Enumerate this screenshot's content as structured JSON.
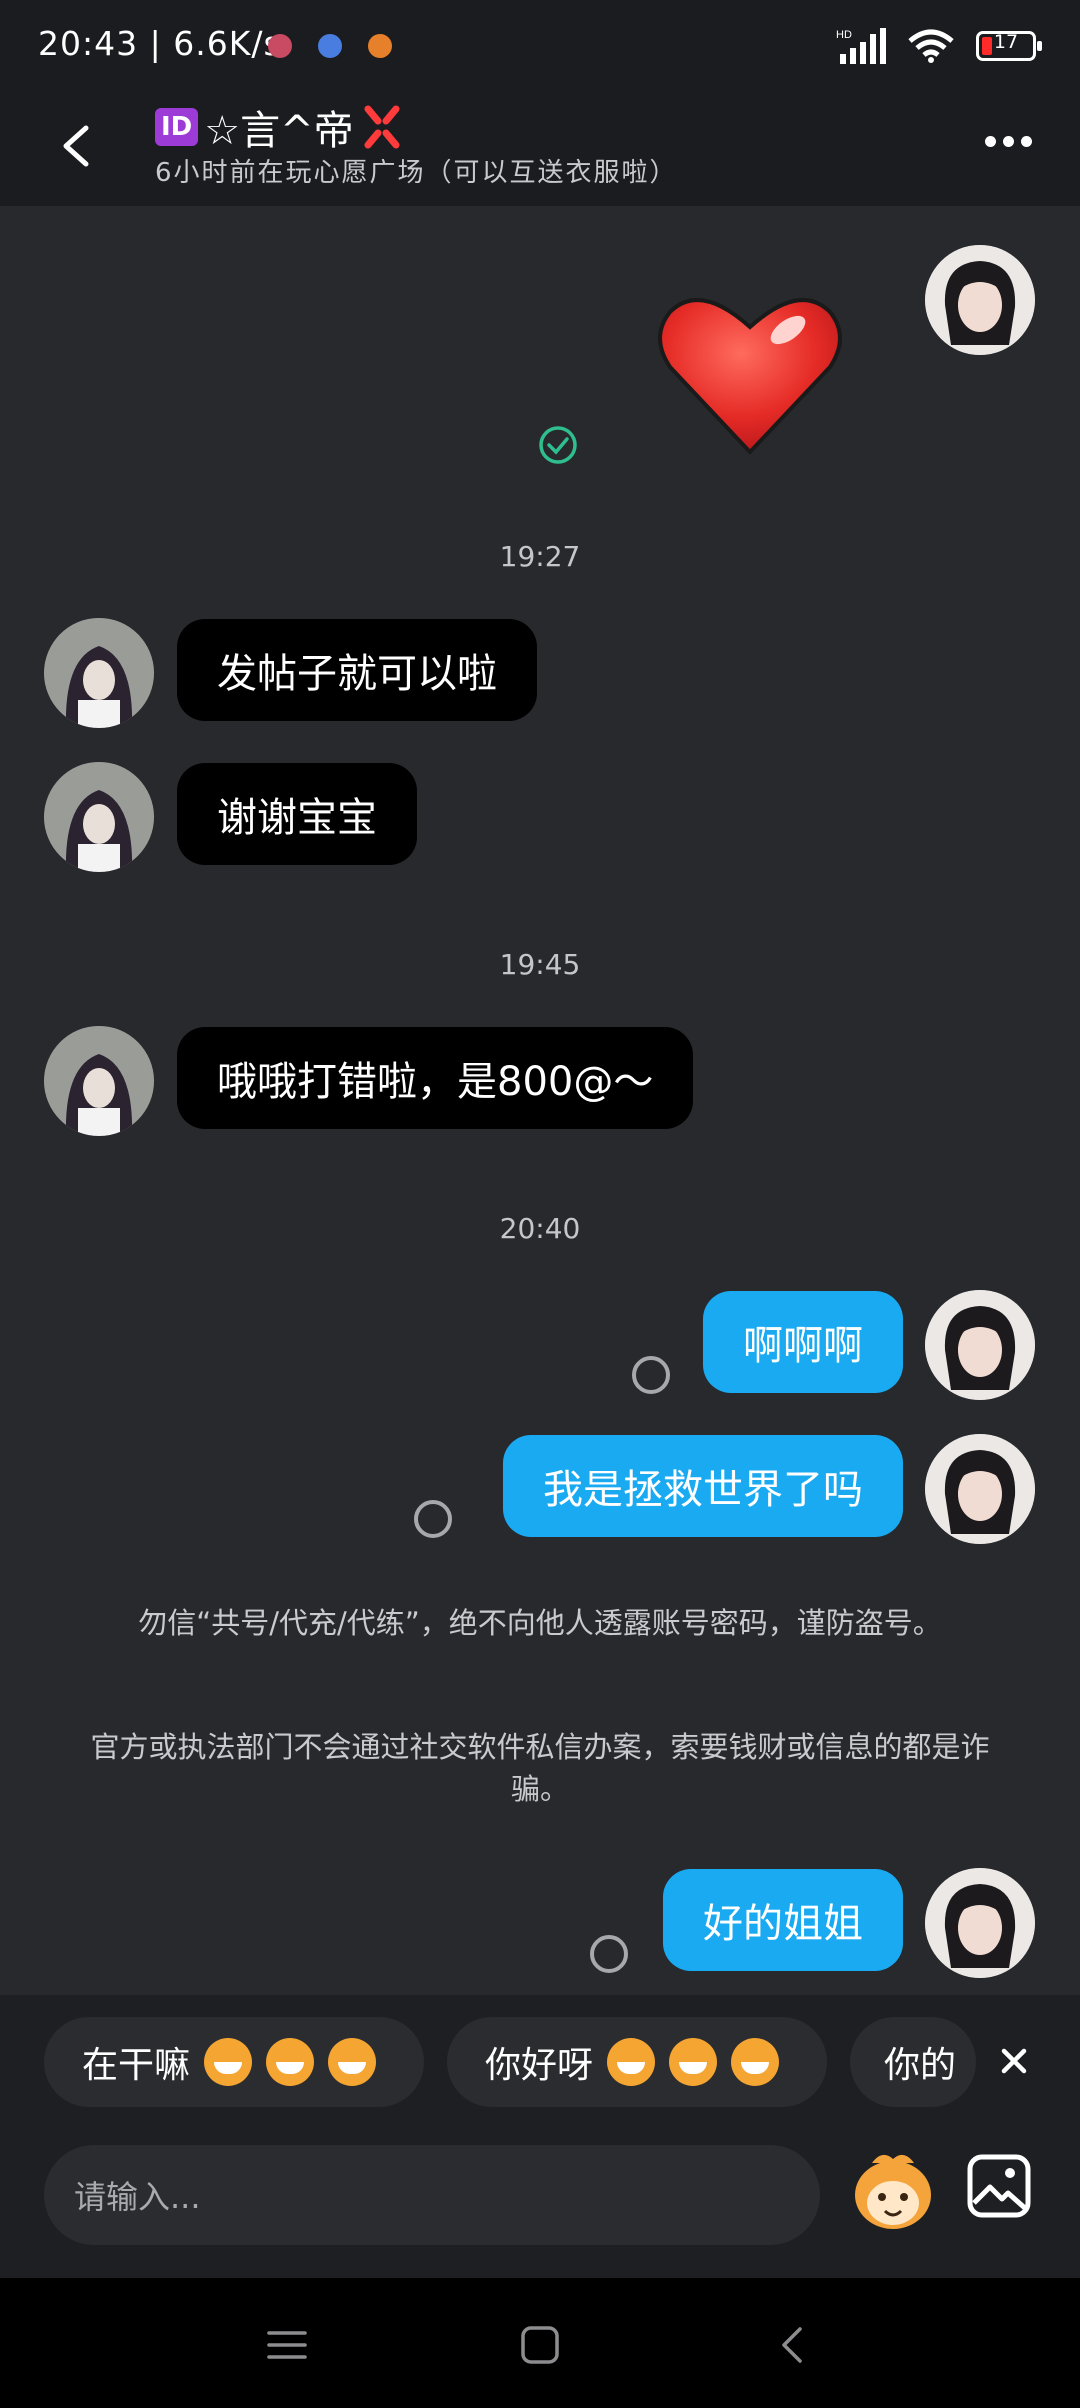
{
  "status_bar": {
    "time": "20:43",
    "speed": "6.6K/s",
    "network": "HD",
    "battery": "17"
  },
  "header": {
    "badge": "ID",
    "name": "☆言^帝",
    "subtitle": "6小时前在玩心愿广场（可以互送衣服啦）"
  },
  "messages": [
    {
      "type": "time",
      "text": "19:27"
    },
    {
      "from": "other",
      "text": "发帖子就可以啦"
    },
    {
      "from": "other",
      "text": "谢谢宝宝"
    },
    {
      "type": "time",
      "text": "19:45"
    },
    {
      "from": "other",
      "text": "哦哦打错啦，是800@～"
    },
    {
      "type": "time",
      "text": "20:40"
    },
    {
      "from": "self",
      "text": "啊啊啊"
    },
    {
      "from": "self",
      "text": "我是拯救世界了吗"
    },
    {
      "type": "notice",
      "text": "勿信“共号/代充/代练”，绝不向他人透露账号密码，谨防盗号。"
    },
    {
      "type": "notice",
      "text": "官方或执法部门不会通过社交软件私信办案，索要钱财或信息的都是诈骗。"
    },
    {
      "from": "self",
      "text": "好的姐姐"
    }
  ],
  "quick_replies": [
    "在干嘛",
    "你好呀",
    "你的"
  ],
  "input": {
    "placeholder": "请输入..."
  },
  "colors": {
    "self_bubble": "#1aaaf2",
    "other_bubble": "#000000",
    "background": "#27292d",
    "read_check": "#2fbf8f"
  },
  "icons": [
    "back-icon",
    "more-icon",
    "heart-sticker",
    "read-check-icon",
    "close-icon",
    "mascot-emoji-icon",
    "gallery-icon",
    "menu-icon",
    "home-icon",
    "back-nav-icon"
  ]
}
